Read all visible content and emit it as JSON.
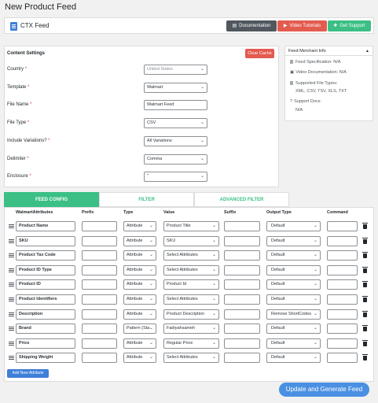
{
  "page_title": "New Product Feed",
  "topbar": {
    "brand": "CTX Feed",
    "buttons": [
      {
        "label": "Documentation",
        "color": "#50575e",
        "icon": "document-icon"
      },
      {
        "label": "Video Tutorials",
        "color": "#e35b4f",
        "icon": "youtube-icon"
      },
      {
        "label": "Get Support",
        "color": "#3bbf84",
        "icon": "support-icon"
      }
    ]
  },
  "content_settings": {
    "header": "Content Settings",
    "clear_cache": "Clear Cache",
    "fields": [
      {
        "label": "Country",
        "required": "*",
        "value": "United States",
        "type": "select",
        "placeholder_style": true
      },
      {
        "label": "Template",
        "required": "*",
        "value": "Walmart",
        "type": "select"
      },
      {
        "label": "File Name",
        "required": "*",
        "value": "Walmart Feed",
        "type": "input"
      },
      {
        "label": "File Type",
        "required": "*",
        "value": "CSV",
        "type": "select"
      },
      {
        "label": "Include Variations?",
        "required": "*",
        "value": "All Variations",
        "type": "select"
      },
      {
        "label": "Delimiter",
        "required": "*",
        "value": "Comma",
        "type": "select"
      },
      {
        "label": "Enclosure",
        "required": "*",
        "value": "\"",
        "type": "select"
      }
    ]
  },
  "merchant_info": {
    "header": "Feed Merchant Info",
    "feed_spec": "Feed Specification: N/A",
    "video_doc": "Video Documentation: N/A",
    "supported_types_label": "Supported File Types:",
    "supported_types": "XML, CSV, TSV, XLS, TXT",
    "support_docs_label": "Support Docs:",
    "support_docs": "N/A"
  },
  "tabs": [
    {
      "label": "FEED CONFIG",
      "active": true
    },
    {
      "label": "FILTER",
      "active": false
    },
    {
      "label": "ADVANCED FILTER",
      "active": false
    }
  ],
  "table": {
    "headers": [
      "WalmartAttributes",
      "Prefix",
      "Type",
      "Value",
      "Suffix",
      "Output Type",
      "Command"
    ],
    "rows": [
      {
        "attr": "Product Name",
        "prefix": "",
        "type": "Attribute",
        "value": "Product Title",
        "suffix": "",
        "output": "Default",
        "command": ""
      },
      {
        "attr": "SKU",
        "prefix": "",
        "type": "Attribute",
        "value": "SKU",
        "suffix": "",
        "output": "Default",
        "command": ""
      },
      {
        "attr": "Product Tax Code",
        "prefix": "",
        "type": "Attribute",
        "value": "Select Attributes",
        "suffix": "",
        "output": "Default",
        "command": ""
      },
      {
        "attr": "Product ID Type",
        "prefix": "",
        "type": "Attribute",
        "value": "Select Attributes",
        "suffix": "",
        "output": "Default",
        "command": ""
      },
      {
        "attr": "Product ID",
        "prefix": "",
        "type": "Attribute",
        "value": "Product Id",
        "suffix": "",
        "output": "Default",
        "command": ""
      },
      {
        "attr": "Product Identifiers",
        "prefix": "",
        "type": "Attribute",
        "value": "Select Attributes",
        "suffix": "",
        "output": "Default",
        "command": ""
      },
      {
        "attr": "Description",
        "prefix": "",
        "type": "Attribute",
        "value": "Product Description",
        "suffix": "",
        "output": "Remove ShortCodes",
        "command": ""
      },
      {
        "attr": "Brand",
        "prefix": "",
        "type": "Pattern (Sta",
        "value": "Fadiyahsameh",
        "suffix": "",
        "output": "Default",
        "command": ""
      },
      {
        "attr": "Price",
        "prefix": "",
        "type": "Attribute",
        "value": "Regular Price",
        "suffix": "",
        "output": "Default",
        "command": ""
      },
      {
        "attr": "Shipping Weight",
        "prefix": "",
        "type": "Attribute",
        "value": "Select Attributes",
        "suffix": "",
        "output": "Default",
        "command": ""
      }
    ]
  },
  "add_attribute": "Add New Attribute",
  "generate": "Update and Generate Feed"
}
